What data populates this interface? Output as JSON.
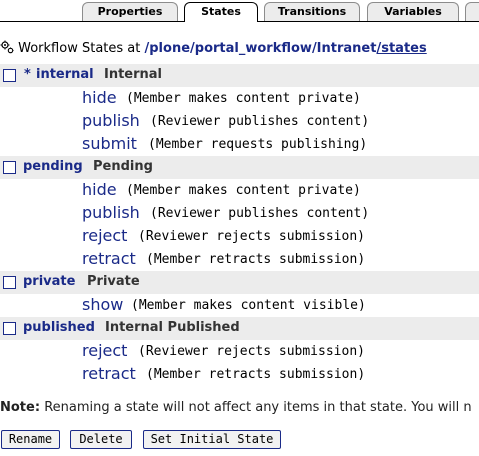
{
  "tabs": [
    {
      "label": "Properties"
    },
    {
      "label": "States"
    },
    {
      "label": "Transitions"
    },
    {
      "label": "Variables"
    }
  ],
  "heading": {
    "prefix": "Workflow States at",
    "path_segments": [
      "/plone",
      "/portal_workflow",
      "/Intranet",
      "/states"
    ]
  },
  "states": [
    {
      "marker": "*",
      "id": "internal",
      "title": "Internal",
      "transitions": [
        {
          "name": "hide",
          "desc": "(Member makes content private)"
        },
        {
          "name": "publish",
          "desc": "(Reviewer publishes content)"
        },
        {
          "name": "submit",
          "desc": "(Member requests publishing)"
        }
      ]
    },
    {
      "marker": "",
      "id": "pending",
      "title": "Pending",
      "transitions": [
        {
          "name": "hide",
          "desc": "(Member makes content private)"
        },
        {
          "name": "publish",
          "desc": "(Reviewer publishes content)"
        },
        {
          "name": "reject",
          "desc": "(Reviewer rejects submission)"
        },
        {
          "name": "retract",
          "desc": "(Member retracts submission)"
        }
      ]
    },
    {
      "marker": "",
      "id": "private",
      "title": "Private",
      "transitions": [
        {
          "name": "show",
          "desc": "(Member makes content visible)"
        }
      ]
    },
    {
      "marker": "",
      "id": "published",
      "title": "Internal Published",
      "transitions": [
        {
          "name": "reject",
          "desc": "(Reviewer rejects submission)"
        },
        {
          "name": "retract",
          "desc": "(Member retracts submission)"
        }
      ]
    }
  ],
  "note": {
    "label": "Note:",
    "text": "Renaming a state will not affect any items in that state. You will n"
  },
  "buttons": {
    "rename": "Rename",
    "delete": "Delete",
    "set_initial": "Set Initial State"
  }
}
